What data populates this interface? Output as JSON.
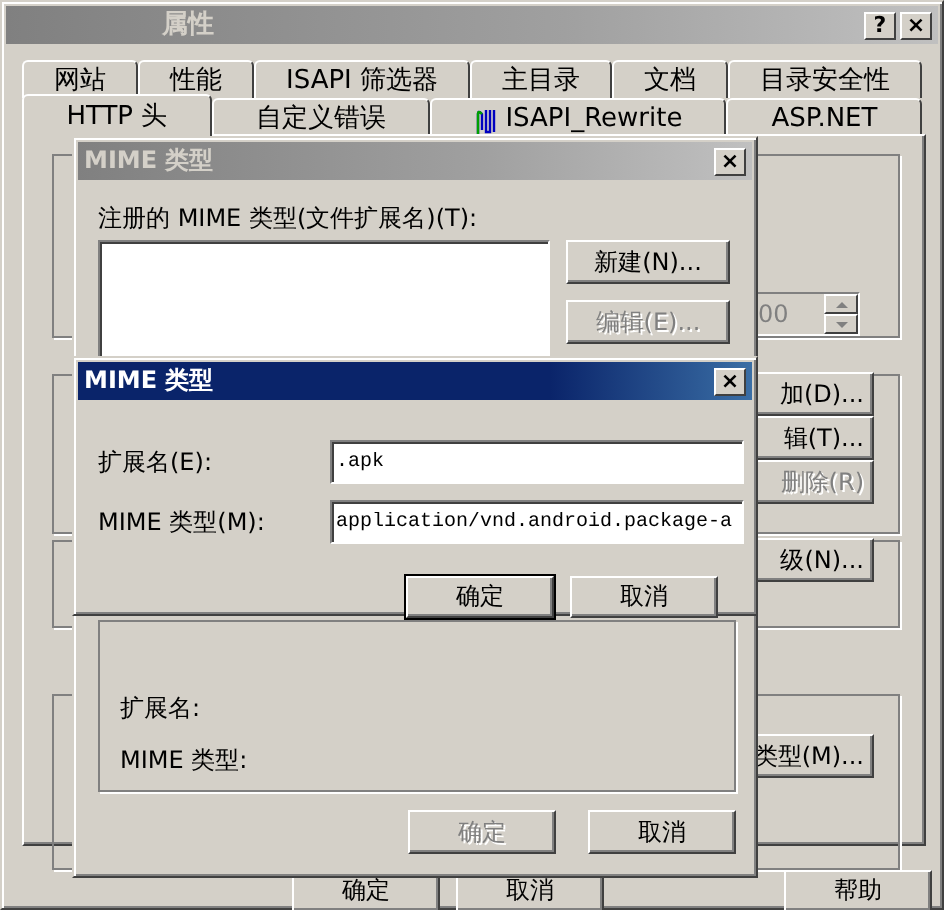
{
  "window": {
    "title": "属性",
    "buttons": [
      "?",
      "×"
    ],
    "active": false
  },
  "tabs_row_1": [
    {
      "label": "网站",
      "selected": false
    },
    {
      "label": "性能",
      "selected": false
    },
    {
      "label": "ISAPI 筛选器",
      "selected": false
    },
    {
      "label": "主目录",
      "selected": false
    },
    {
      "label": "文档",
      "selected": false
    },
    {
      "label": "目录安全性",
      "selected": false
    }
  ],
  "tabs_row_2": [
    {
      "label": "HTTP 头",
      "selected": true,
      "kind": "plain"
    },
    {
      "label": "自定义错误",
      "selected": false,
      "kind": "plain"
    },
    {
      "label": "ISAPI_Rewrite",
      "selected": false,
      "kind": "with_icon"
    },
    {
      "label": "ASP.NET",
      "selected": false,
      "kind": "plain"
    }
  ],
  "background_controls": [
    {
      "kind": "spinner",
      "label": "00",
      "disabled": true
    },
    {
      "kind": "button",
      "label": "加(D)...",
      "disabled": false
    },
    {
      "kind": "button",
      "label": "辑(T)...",
      "disabled": false
    },
    {
      "kind": "button",
      "label": "删除(R)",
      "disabled": true
    },
    {
      "kind": "button",
      "label": "级(N)...",
      "disabled": false
    },
    {
      "kind": "button",
      "label": "类型(M)...",
      "disabled": false
    }
  ],
  "footer_buttons": [
    {
      "label": "确定"
    },
    {
      "label": "取消"
    },
    {
      "label": "帮助"
    }
  ],
  "mime_list_dialog": {
    "title": "MIME 类型",
    "active": false,
    "close": "×",
    "list_label": "注册的 MIME 类型(文件扩展名)(T):",
    "buttons": [
      {
        "label": "新建(N)...",
        "disabled": false
      },
      {
        "label": "编辑(E)...",
        "disabled": true
      }
    ],
    "details": [
      "扩展名:",
      "MIME 类型:"
    ],
    "footer_buttons": [
      {
        "label": "确定",
        "disabled": true
      },
      {
        "label": "取消",
        "disabled": false
      }
    ]
  },
  "mime_edit_dialog": {
    "title": "MIME 类型",
    "active": true,
    "close": "×",
    "fields": [
      {
        "label": "扩展名(E):",
        "value": ".apk"
      },
      {
        "label": "MIME 类型(M):",
        "value": "application/vnd.android.package-a"
      }
    ],
    "buttons": [
      {
        "label": "确定",
        "default": true
      },
      {
        "label": "取消",
        "default": false
      }
    ]
  }
}
